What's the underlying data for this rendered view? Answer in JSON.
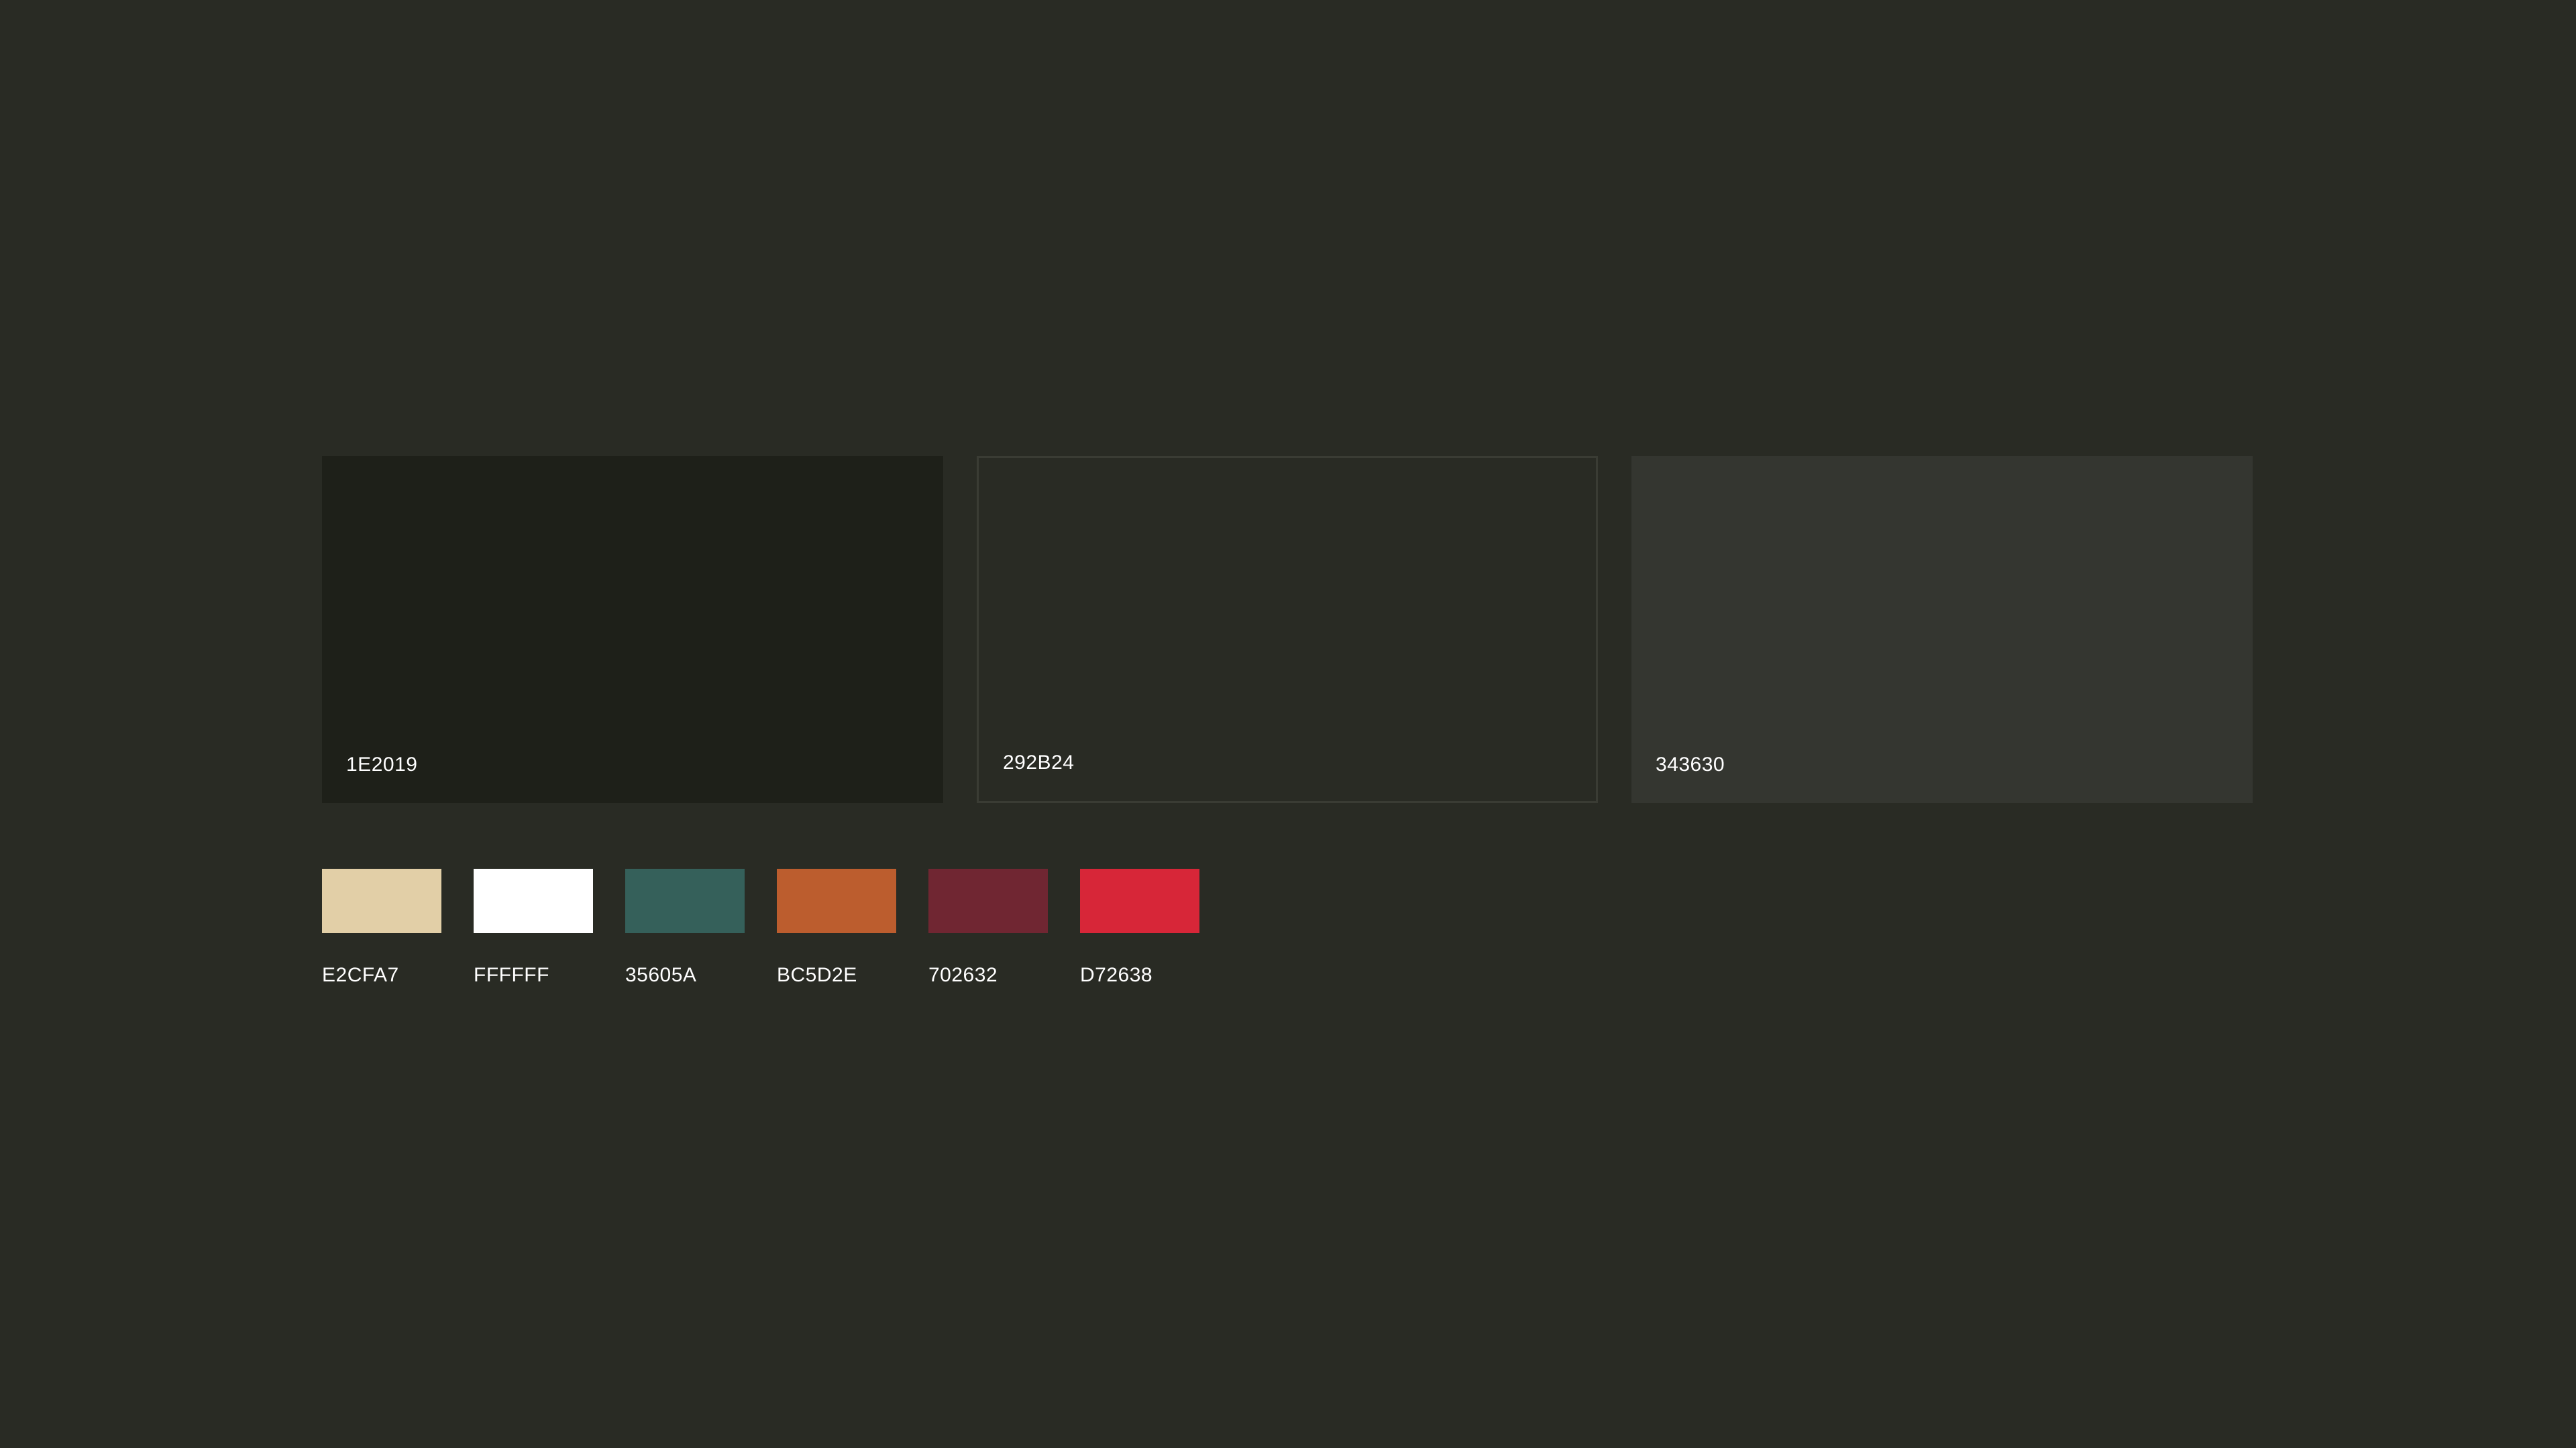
{
  "primary_colors": [
    {
      "hex_label": "1E2019",
      "color": "#1E2019"
    },
    {
      "hex_label": "292B24",
      "color": "#292B24"
    },
    {
      "hex_label": "343630",
      "color": "#343630"
    }
  ],
  "accent_colors": [
    {
      "hex_label": "E2CFA7",
      "color": "#E2CFA7"
    },
    {
      "hex_label": "FFFFFF",
      "color": "#FFFFFF"
    },
    {
      "hex_label": "35605A",
      "color": "#35605A"
    },
    {
      "hex_label": "BC5D2E",
      "color": "#BC5D2E"
    },
    {
      "hex_label": "702632",
      "color": "#702632"
    },
    {
      "hex_label": "D72638",
      "color": "#D72638"
    }
  ],
  "background_color": "#292B24"
}
